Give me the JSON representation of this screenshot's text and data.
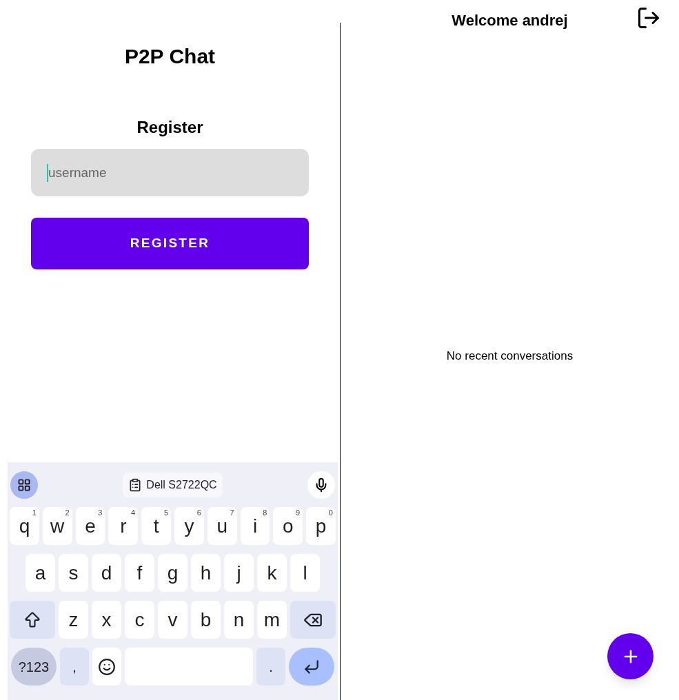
{
  "register_screen": {
    "title": "P2P Chat",
    "heading": "Register",
    "username_field": {
      "placeholder": "username"
    },
    "register_button": "REGISTER"
  },
  "keyboard": {
    "clipboard_suggestion": "Dell S2722QC",
    "rows": [
      {
        "keys": [
          {
            "kind": "letter",
            "label": "q",
            "hint": "1"
          },
          {
            "kind": "letter",
            "label": "w",
            "hint": "2"
          },
          {
            "kind": "letter",
            "label": "e",
            "hint": "3"
          },
          {
            "kind": "letter",
            "label": "r",
            "hint": "4"
          },
          {
            "kind": "letter",
            "label": "t",
            "hint": "5"
          },
          {
            "kind": "letter",
            "label": "y",
            "hint": "6"
          },
          {
            "kind": "letter",
            "label": "u",
            "hint": "7"
          },
          {
            "kind": "letter",
            "label": "i",
            "hint": "8"
          },
          {
            "kind": "letter",
            "label": "o",
            "hint": "9"
          },
          {
            "kind": "letter",
            "label": "p",
            "hint": "0"
          }
        ]
      },
      {
        "keys": [
          {
            "kind": "letter",
            "label": "a"
          },
          {
            "kind": "letter",
            "label": "s"
          },
          {
            "kind": "letter",
            "label": "d"
          },
          {
            "kind": "letter",
            "label": "f"
          },
          {
            "kind": "letter",
            "label": "g"
          },
          {
            "kind": "letter",
            "label": "h"
          },
          {
            "kind": "letter",
            "label": "j"
          },
          {
            "kind": "letter",
            "label": "k"
          },
          {
            "kind": "letter",
            "label": "l"
          }
        ]
      },
      {
        "keys": [
          {
            "kind": "shift"
          },
          {
            "kind": "letter",
            "label": "z"
          },
          {
            "kind": "letter",
            "label": "x"
          },
          {
            "kind": "letter",
            "label": "c"
          },
          {
            "kind": "letter",
            "label": "v"
          },
          {
            "kind": "letter",
            "label": "b"
          },
          {
            "kind": "letter",
            "label": "n"
          },
          {
            "kind": "letter",
            "label": "m"
          },
          {
            "kind": "backspace"
          }
        ]
      },
      {
        "keys": [
          {
            "kind": "symbols",
            "label": "?123"
          },
          {
            "kind": "punct",
            "label": ","
          },
          {
            "kind": "emoji"
          },
          {
            "kind": "space"
          },
          {
            "kind": "punct",
            "label": "."
          },
          {
            "kind": "enter"
          }
        ]
      }
    ]
  },
  "conversations_screen": {
    "title": "Welcome andrej",
    "empty_message": "No recent conversations"
  }
}
